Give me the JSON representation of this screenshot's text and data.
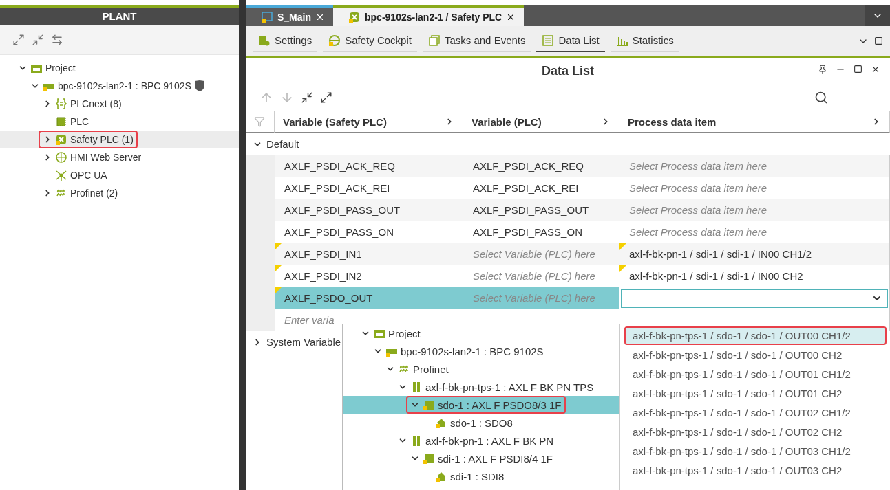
{
  "plant": {
    "title": "PLANT",
    "tree": [
      {
        "label": "Project",
        "kind": "folder",
        "expanded": true,
        "selected": false,
        "highlighted": false,
        "children": [
          {
            "label": "bpc-9102s-lan2-1 : BPC 9102S",
            "kind": "device",
            "expanded": true,
            "selected": false,
            "highlighted": false,
            "shield": true,
            "children": [
              {
                "label": "PLCnext (8)",
                "kind": "plcnext",
                "expanded": false,
                "selected": false,
                "highlighted": false
              },
              {
                "label": "PLC",
                "kind": "chip",
                "selected": false,
                "highlighted": false
              },
              {
                "label": "Safety PLC (1)",
                "kind": "safety",
                "expanded": false,
                "selected": true,
                "highlighted": true
              },
              {
                "label": "HMI Web Server",
                "kind": "globe",
                "expanded": false,
                "selected": false,
                "highlighted": false
              },
              {
                "label": "OPC UA",
                "kind": "network",
                "selected": false,
                "highlighted": false
              },
              {
                "label": "Profinet (2)",
                "kind": "bus",
                "expanded": false,
                "selected": false,
                "highlighted": false
              }
            ]
          }
        ]
      }
    ]
  },
  "tabs": [
    {
      "label": "S_Main",
      "kind": "program",
      "selected": false
    },
    {
      "label": "bpc-9102s-lan2-1 / Safety PLC",
      "kind": "safety",
      "selected": true
    }
  ],
  "subtabs": [
    {
      "label": "Settings",
      "kind": "settings",
      "selected": false
    },
    {
      "label": "Safety Cockpit",
      "kind": "cockpit",
      "selected": false
    },
    {
      "label": "Tasks and Events",
      "kind": "tasks",
      "selected": false
    },
    {
      "label": "Data List",
      "kind": "list",
      "selected": true
    },
    {
      "label": "Statistics",
      "kind": "stats",
      "selected": false
    }
  ],
  "panel": {
    "title": "Data List"
  },
  "columns": [
    "Variable (Safety PLC)",
    "Variable (PLC)",
    "Process data item"
  ],
  "groups": [
    {
      "label": "Default",
      "expanded": true,
      "rows": [
        {
          "selected": false,
          "cells": [
            {
              "text": "AXLF_PSDI_ACK_REQ",
              "kind": "value",
              "flag": false
            },
            {
              "text": "AXLF_PSDI_ACK_REQ",
              "kind": "value",
              "flag": false
            },
            {
              "text": "Select Process data item here",
              "kind": "placeholder",
              "flag": false
            }
          ]
        },
        {
          "selected": false,
          "cells": [
            {
              "text": "AXLF_PSDI_ACK_REI",
              "kind": "value",
              "flag": false
            },
            {
              "text": "AXLF_PSDI_ACK_REI",
              "kind": "value",
              "flag": false
            },
            {
              "text": "Select Process data item here",
              "kind": "placeholder",
              "flag": false
            }
          ]
        },
        {
          "selected": false,
          "cells": [
            {
              "text": "AXLF_PSDI_PASS_OUT",
              "kind": "value",
              "flag": false
            },
            {
              "text": "AXLF_PSDI_PASS_OUT",
              "kind": "value",
              "flag": false
            },
            {
              "text": "Select Process data item here",
              "kind": "placeholder",
              "flag": false
            }
          ]
        },
        {
          "selected": false,
          "cells": [
            {
              "text": "AXLF_PSDI_PASS_ON",
              "kind": "value",
              "flag": false
            },
            {
              "text": "AXLF_PSDI_PASS_ON",
              "kind": "value",
              "flag": false
            },
            {
              "text": "Select Process data item here",
              "kind": "placeholder",
              "flag": false
            }
          ]
        },
        {
          "selected": false,
          "cells": [
            {
              "text": "AXLF_PSDI_IN1",
              "kind": "value",
              "flag": true
            },
            {
              "text": "Select Variable (PLC) here",
              "kind": "placeholder",
              "flag": false
            },
            {
              "text": "axl-f-bk-pn-1 / sdi-1 / sdi-1 / IN00 CH1/2",
              "kind": "value",
              "flag": true
            }
          ]
        },
        {
          "selected": false,
          "cells": [
            {
              "text": "AXLF_PSDI_IN2",
              "kind": "value",
              "flag": true
            },
            {
              "text": "Select Variable (PLC) here",
              "kind": "placeholder",
              "flag": false
            },
            {
              "text": "axl-f-bk-pn-1 / sdi-1 / sdi-1 / IN00 CH2",
              "kind": "value",
              "flag": true
            }
          ]
        },
        {
          "selected": true,
          "cells": [
            {
              "text": "AXLF_PSDO_OUT",
              "kind": "value",
              "flag": true
            },
            {
              "text": "Select Variable (PLC) here",
              "kind": "placeholder",
              "flag": false
            },
            {
              "text": "",
              "kind": "editor",
              "flag": false
            }
          ]
        },
        {
          "selected": false,
          "cells": [
            {
              "text": "Enter varia",
              "kind": "placeholder",
              "flag": false
            }
          ]
        }
      ]
    },
    {
      "label": "System Variable",
      "expanded": false
    }
  ],
  "picker": {
    "tree": [
      {
        "label": "Project",
        "kind": "folder",
        "expanded": true,
        "selected": false,
        "highlighted": false,
        "children": [
          {
            "label": "bpc-9102s-lan2-1 : BPC 9102S",
            "kind": "device",
            "expanded": true,
            "selected": false,
            "highlighted": false,
            "children": [
              {
                "label": "Profinet",
                "kind": "bus",
                "expanded": true,
                "selected": false,
                "highlighted": false,
                "children": [
                  {
                    "label": "axl-f-bk-pn-tps-1 : AXL F BK PN TPS",
                    "kind": "coupler",
                    "expanded": true,
                    "selected": false,
                    "highlighted": false,
                    "children": [
                      {
                        "label": "sdo-1 : AXL F PSDO8/3 1F",
                        "kind": "module",
                        "expanded": true,
                        "selected": true,
                        "highlighted": true,
                        "children": [
                          {
                            "label": "sdo-1 : SDO8",
                            "kind": "submodule",
                            "selected": false,
                            "highlighted": false
                          }
                        ]
                      }
                    ]
                  },
                  {
                    "label": "axl-f-bk-pn-1 : AXL F BK PN",
                    "kind": "coupler",
                    "expanded": true,
                    "selected": false,
                    "highlighted": false,
                    "children": [
                      {
                        "label": "sdi-1 : AXL F PSDI8/4 1F",
                        "kind": "module",
                        "expanded": true,
                        "selected": false,
                        "highlighted": false,
                        "children": [
                          {
                            "label": "sdi-1 : SDI8",
                            "kind": "submodule",
                            "selected": false,
                            "highlighted": false
                          }
                        ]
                      }
                    ]
                  }
                ]
              }
            ]
          }
        ]
      }
    ]
  },
  "options": [
    {
      "label": "axl-f-bk-pn-tps-1 / sdo-1 / sdo-1 / OUT00 CH1/2",
      "selected": true
    },
    {
      "label": "axl-f-bk-pn-tps-1 / sdo-1 / sdo-1 / OUT00 CH2",
      "selected": false
    },
    {
      "label": "axl-f-bk-pn-tps-1 / sdo-1 / sdo-1 / OUT01 CH1/2",
      "selected": false
    },
    {
      "label": "axl-f-bk-pn-tps-1 / sdo-1 / sdo-1 / OUT01 CH2",
      "selected": false
    },
    {
      "label": "axl-f-bk-pn-tps-1 / sdo-1 / sdo-1 / OUT02 CH1/2",
      "selected": false
    },
    {
      "label": "axl-f-bk-pn-tps-1 / sdo-1 / sdo-1 / OUT02 CH2",
      "selected": false
    },
    {
      "label": "axl-f-bk-pn-tps-1 / sdo-1 / sdo-1 / OUT03 CH1/2",
      "selected": false
    },
    {
      "label": "axl-f-bk-pn-tps-1 / sdo-1 / sdo-1 / OUT03 CH2",
      "selected": false
    }
  ]
}
